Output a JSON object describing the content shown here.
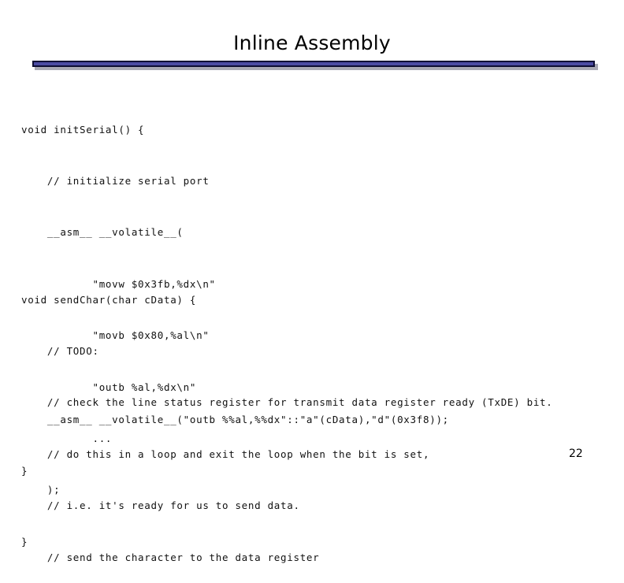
{
  "slide": {
    "title": "Inline Assembly",
    "page_number": "22"
  },
  "code_block_1": {
    "lines": [
      "void initSerial() {",
      "    // initialize serial port",
      "    __asm__ __volatile__(",
      "           \"movw $0x3fb,%dx\\n\"",
      "           \"movb $0x80,%al\\n\"",
      "           \"outb %al,%dx\\n\"",
      "           ...",
      "    );",
      "}"
    ]
  },
  "code_block_2": {
    "lines": [
      "void sendChar(char cData) {",
      "    // TODO:",
      "    // check the line status register for transmit data register ready (TxDE) bit.",
      "    // do this in a loop and exit the loop when the bit is set,",
      "    // i.e. it's ready for us to send data.",
      "    // send the character to the data register"
    ]
  },
  "code_block_3": {
    "lines": [
      "    __asm__ __volatile__(\"outb %%al,%%dx\"::\"a\"(cData),\"d\"(0x3f8));",
      "}"
    ]
  },
  "colors": {
    "title_rule_fill": "#4b4ba3",
    "title_rule_border": "#0d0d33",
    "title_rule_shadow": "#a9a9b4"
  }
}
